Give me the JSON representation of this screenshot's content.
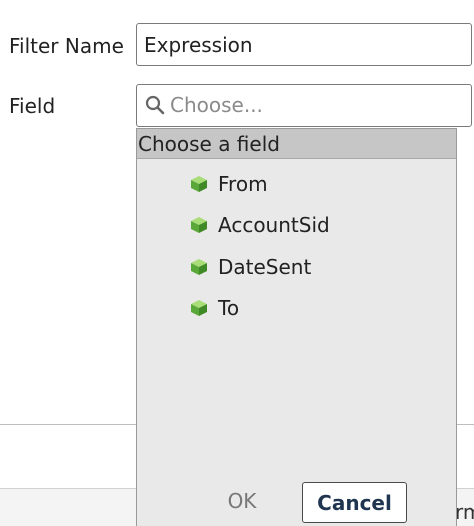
{
  "form": {
    "filter_name_label": "Filter Name",
    "filter_name_value": "Expression",
    "field_label": "Field",
    "field_placeholder": "Choose..."
  },
  "dropdown": {
    "header": "Choose a field",
    "items": [
      {
        "label": "From",
        "icon": "cube-icon"
      },
      {
        "label": "AccountSid",
        "icon": "cube-icon"
      },
      {
        "label": "DateSent",
        "icon": "cube-icon"
      },
      {
        "label": "To",
        "icon": "cube-icon"
      }
    ],
    "ok_label": "OK",
    "cancel_label": "Cancel"
  },
  "footer": {
    "cutoff_text": "rm"
  },
  "colors": {
    "dropdown_bg": "#e9e9e9",
    "header_bg": "#c6c6c6",
    "cube_green": "#5aa83a",
    "cancel_text": "#1f3550"
  }
}
